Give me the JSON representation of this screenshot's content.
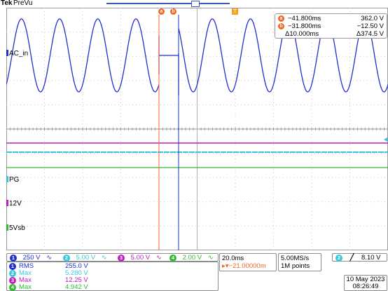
{
  "header": {
    "brand": "Tek",
    "mode": "PreVu"
  },
  "colors": {
    "ch1": "#1f2fd0",
    "ch2": "#35c8dc",
    "ch3": "#c01cc0",
    "ch4": "#33b833",
    "cursor": "#f26522",
    "trigger": "#f7a21b"
  },
  "channels": {
    "ch1": {
      "number": "1",
      "label": "AC_in"
    },
    "ch2": {
      "number": "2",
      "label": "PG"
    },
    "ch3": {
      "number": "3",
      "label": "12V"
    },
    "ch4": {
      "number": "4",
      "label": "5Vsb"
    }
  },
  "cursors": {
    "a": {
      "marker": "a",
      "time": "−41.800ms",
      "value": "362.0 V"
    },
    "b": {
      "marker": "b",
      "time": "−31.800ms",
      "value": "−12.50 V"
    },
    "delta_time": "Δ10.000ms",
    "delta_value": "Δ374.5 V"
  },
  "trigger_marker": "T",
  "vertical_scales": [
    {
      "channel": "1",
      "scale": "250 V",
      "coupling": "∿"
    },
    {
      "channel": "2",
      "scale": "5.00 V",
      "coupling": "∿"
    },
    {
      "channel": "3",
      "scale": "5.00 V",
      "coupling": "∿"
    },
    {
      "channel": "4",
      "scale": "2.00 V",
      "coupling": "∿"
    }
  ],
  "measurements": [
    {
      "channel": "1",
      "type": "RMS",
      "value": "255.0 V"
    },
    {
      "channel": "2",
      "type": "Max",
      "value": "5.280 V"
    },
    {
      "channel": "3",
      "type": "Max",
      "value": "12.25 V"
    },
    {
      "channel": "4",
      "type": "Max",
      "value": "4.942 V"
    }
  ],
  "timebase": {
    "scale": "20.0ms",
    "position": "▸▾−21.00000m"
  },
  "acquisition": {
    "sample_rate": "5.00MS/s",
    "record_length": "1M points"
  },
  "trigger": {
    "source": "2",
    "slope": "╱",
    "level": "8.10 V"
  },
  "datetime": {
    "date": "10 May 2023",
    "time": "08:26:49"
  }
}
